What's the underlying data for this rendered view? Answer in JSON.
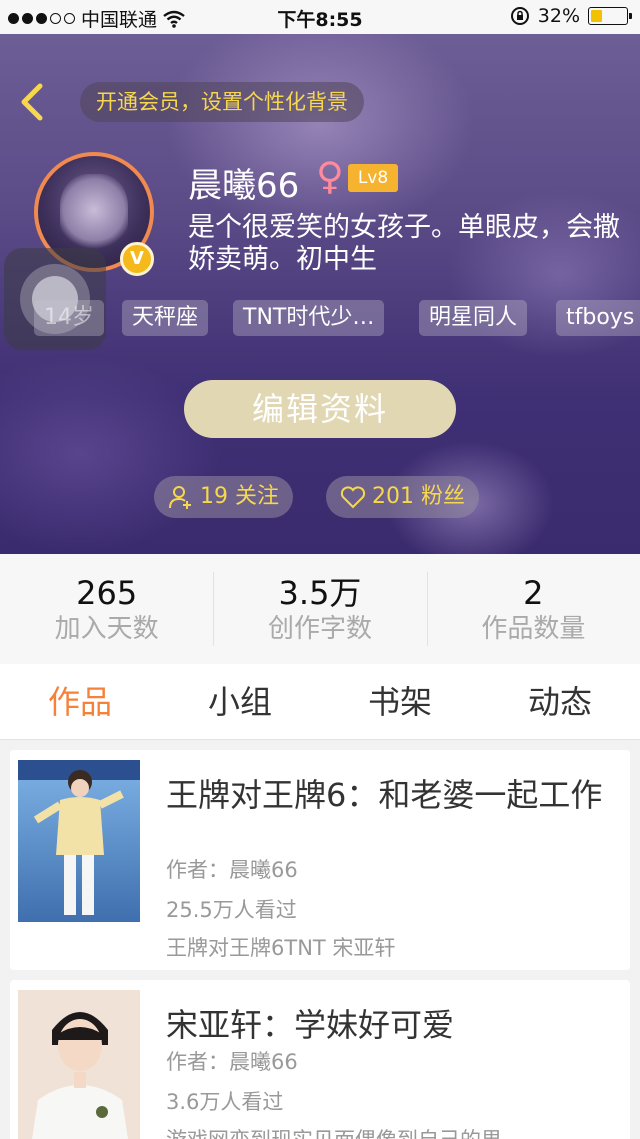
{
  "status_bar": {
    "carrier": "中国联通",
    "time": "下午8:55",
    "battery_percent": "32%",
    "battery_level": 0.32
  },
  "header": {
    "vip_prompt": "开通会员，设置个性化背景",
    "username": "晨曦66",
    "gender_symbol": "♀",
    "level": "Lv8",
    "badge": "V",
    "bio": "是个很爱笑的女孩子。单眼皮，会撒娇卖萌。初中生",
    "tags": [
      "14岁",
      "天秤座",
      "TNT时代少…",
      "明星同人",
      "tfboys"
    ],
    "edit_button": "编辑资料",
    "following": "19 关注",
    "followers": "201 粉丝"
  },
  "stats": [
    {
      "value": "265",
      "label": "加入天数"
    },
    {
      "value": "3.5万",
      "label": "创作字数"
    },
    {
      "value": "2",
      "label": "作品数量"
    }
  ],
  "tabs": [
    "作品",
    "小组",
    "书架",
    "动态"
  ],
  "works": [
    {
      "title": "王牌对王牌6：和老婆一起工作",
      "author": "作者：晨曦66",
      "views": "25.5万人看过",
      "tags": "王牌对王牌6TNT  宋亚轩"
    },
    {
      "title": "宋亚轩：学妹好可爱",
      "author": "作者：晨曦66",
      "views": "3.6万人看过",
      "tags": "游戏网恋到现实见面偶像到自己的男"
    }
  ],
  "colors": {
    "accent": "#f5823b",
    "gold": "#f6d74e",
    "level_badge": "#f5b330"
  }
}
